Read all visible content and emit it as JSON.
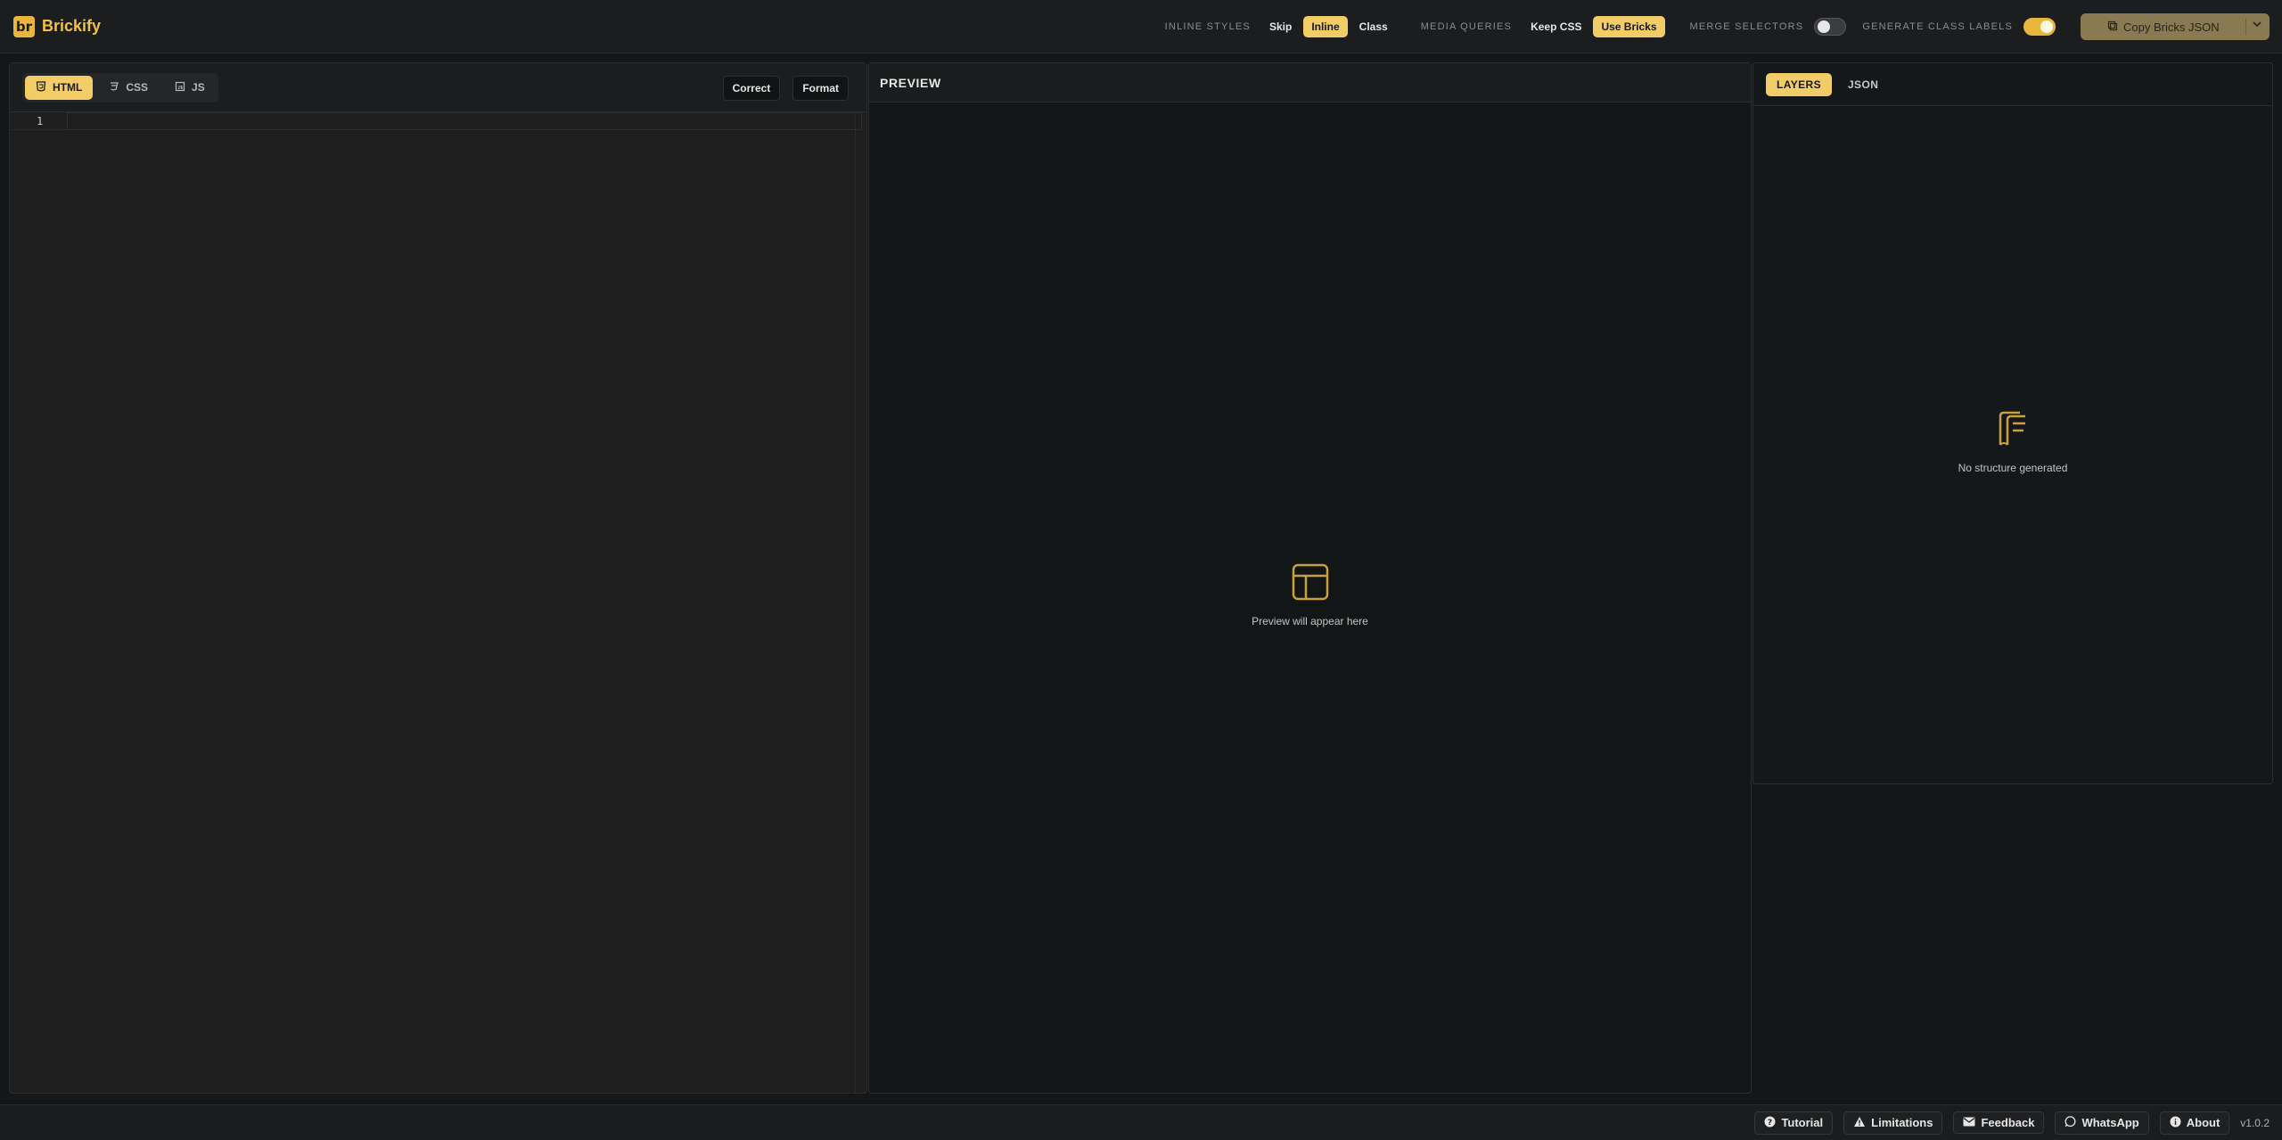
{
  "app": {
    "logo_badge": "br",
    "name": "Brickify"
  },
  "toolbar": {
    "inline_styles": {
      "label": "INLINE STYLES",
      "options": [
        "Skip",
        "Inline",
        "Class"
      ],
      "selected": "Inline"
    },
    "media_queries": {
      "label": "MEDIA QUERIES",
      "options": [
        "Keep CSS",
        "Use Bricks"
      ],
      "selected": "Use Bricks"
    },
    "merge_selectors": {
      "label": "MERGE SELECTORS",
      "on": false
    },
    "generate_class_labels": {
      "label": "GENERATE CLASS LABELS",
      "on": true
    },
    "copy_button": {
      "label": "Copy Bricks JSON",
      "icon": "copy-icon"
    }
  },
  "editor": {
    "tabs": [
      {
        "label": "HTML",
        "icon": "html5-icon",
        "active": true
      },
      {
        "label": "CSS",
        "icon": "css3-icon",
        "active": false
      },
      {
        "label": "JS",
        "icon": "js-icon",
        "active": false
      }
    ],
    "correct_label": "Correct",
    "format_label": "Format",
    "line_numbers": [
      "1"
    ]
  },
  "preview": {
    "title": "PREVIEW",
    "empty_text": "Preview will appear here",
    "empty_icon": "layout-icon"
  },
  "layers": {
    "tabs": [
      {
        "label": "LAYERS",
        "active": true
      },
      {
        "label": "JSON",
        "active": false
      }
    ],
    "empty_text": "No structure generated",
    "empty_icon": "structure-icon"
  },
  "footer": {
    "buttons": [
      {
        "label": "Tutorial",
        "icon": "question-circle-icon"
      },
      {
        "label": "Limitations",
        "icon": "warning-icon"
      },
      {
        "label": "Feedback",
        "icon": "envelope-icon"
      },
      {
        "label": "WhatsApp",
        "icon": "whatsapp-icon"
      },
      {
        "label": "About",
        "icon": "info-circle-icon"
      }
    ],
    "version": "v1.0.2"
  },
  "colors": {
    "accent": "#f2cc66",
    "brand": "#e8b63c",
    "background": "#141617"
  }
}
